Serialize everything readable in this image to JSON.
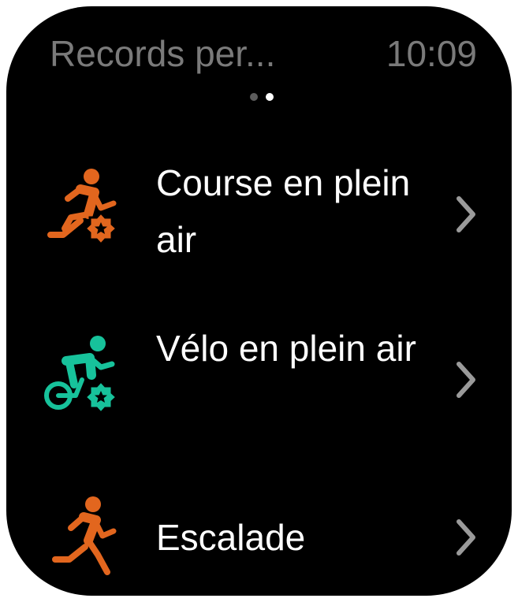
{
  "header": {
    "title": "Records per...",
    "time": "10:09"
  },
  "pager": {
    "pages": 2,
    "current": 2
  },
  "list": {
    "items": [
      {
        "label": "Course en plein air",
        "icon": "outdoor-run-record-icon",
        "icon_color": "#E2661E"
      },
      {
        "label": "Vélo en plein air",
        "icon": "outdoor-cycling-record-icon",
        "icon_color": "#17C29B"
      },
      {
        "label": "Escalade",
        "icon": "climbing-run-icon",
        "icon_color": "#E2661E"
      }
    ],
    "chevron_icon": "chevron-right-icon"
  },
  "colors": {
    "background": "#000000",
    "header_text": "#7A7A7A",
    "item_text": "#FFFFFF",
    "chevron": "#9A9A9A",
    "orange": "#E2661E",
    "teal": "#17C29B"
  }
}
